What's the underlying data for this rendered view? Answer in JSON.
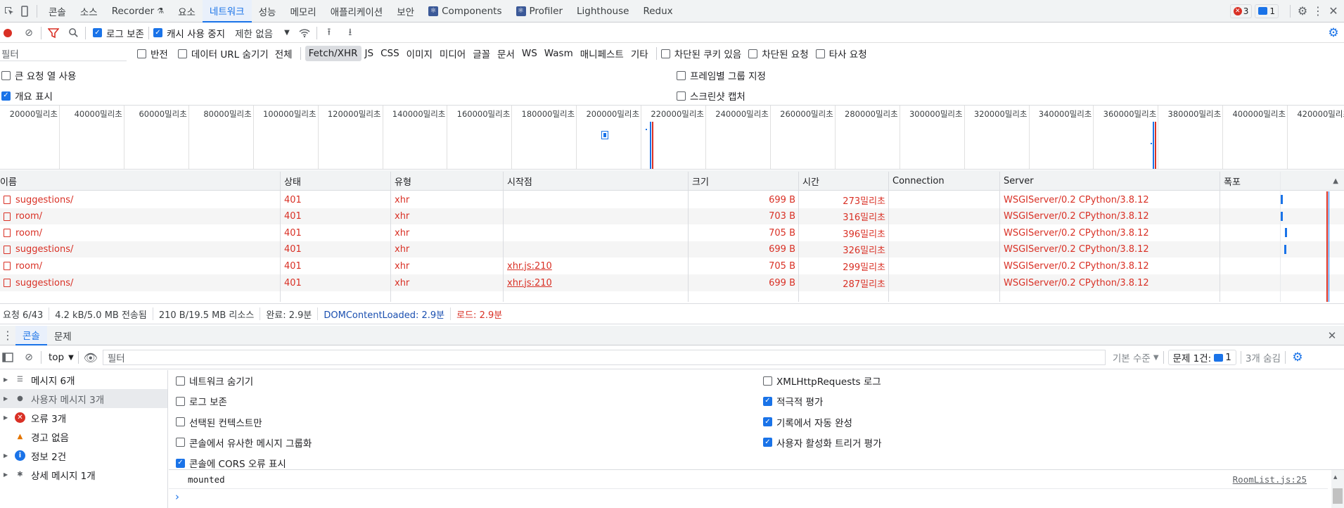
{
  "topbar": {
    "tabs": [
      "콘솔",
      "소스",
      "Recorder",
      "요소",
      "네트워크",
      "성능",
      "메모리",
      "애플리케이션",
      "보안",
      "Components",
      "Profiler",
      "Lighthouse",
      "Redux"
    ],
    "recorder_icon": "flask-icon",
    "error_count": "3",
    "message_count": "1"
  },
  "net_toolbar": {
    "preserve_log": "로그 보존",
    "disable_cache": "캐시 사용 중지",
    "throttle": "제한 없음"
  },
  "filter_bar": {
    "placeholder": "필터",
    "invert": "반전",
    "hide_data_urls": "데이터 URL 숨기기",
    "types": [
      "전체",
      "Fetch/XHR",
      "JS",
      "CSS",
      "이미지",
      "미디어",
      "글꼴",
      "문서",
      "WS",
      "Wasm",
      "매니페스트",
      "기타"
    ],
    "blocked_cookies": "차단된 쿠키 있음",
    "blocked_requests": "차단된 요청",
    "third_party": "타사 요청"
  },
  "settings": {
    "big_rows": "큰 요청 열 사용",
    "group_by_frame": "프레임별 그룹 지정",
    "show_overview": "개요 표시",
    "screenshots": "스크린샷 캡처"
  },
  "timeline": {
    "ticks": [
      "20000밀리초",
      "40000밀리초",
      "60000밀리초",
      "80000밀리초",
      "100000밀리초",
      "120000밀리초",
      "140000밀리초",
      "160000밀리초",
      "180000밀리초",
      "200000밀리초",
      "220000밀리초",
      "240000밀리초",
      "260000밀리초",
      "280000밀리초",
      "300000밀리초",
      "320000밀리초",
      "340000밀리초",
      "360000밀리초",
      "380000밀리초",
      "400000밀리초",
      "420000밀리초"
    ]
  },
  "table": {
    "headers": [
      "이름",
      "상태",
      "유형",
      "시작점",
      "크기",
      "시간",
      "Connection",
      "Server",
      "폭포"
    ],
    "rows": [
      {
        "name": "suggestions/",
        "status": "401",
        "type": "xhr",
        "initiator": "",
        "size": "699 B",
        "time": "273밀리초",
        "server": "WSGIServer/0.2 CPython/3.8.12"
      },
      {
        "name": "room/",
        "status": "401",
        "type": "xhr",
        "initiator": "",
        "size": "703 B",
        "time": "316밀리초",
        "server": "WSGIServer/0.2 CPython/3.8.12"
      },
      {
        "name": "room/",
        "status": "401",
        "type": "xhr",
        "initiator": "",
        "size": "705 B",
        "time": "396밀리초",
        "server": "WSGIServer/0.2 CPython/3.8.12"
      },
      {
        "name": "suggestions/",
        "status": "401",
        "type": "xhr",
        "initiator": "",
        "size": "699 B",
        "time": "326밀리초",
        "server": "WSGIServer/0.2 CPython/3.8.12"
      },
      {
        "name": "room/",
        "status": "401",
        "type": "xhr",
        "initiator": "xhr.js:210",
        "size": "705 B",
        "time": "299밀리초",
        "server": "WSGIServer/0.2 CPython/3.8.12"
      },
      {
        "name": "suggestions/",
        "status": "401",
        "type": "xhr",
        "initiator": "xhr.js:210",
        "size": "699 B",
        "time": "287밀리초",
        "server": "WSGIServer/0.2 CPython/3.8.12"
      }
    ]
  },
  "statusbar": {
    "requests": "요청 6/43",
    "transferred": "4.2 kB/5.0 MB 전송됨",
    "resources": "210 B/19.5 MB 리소스",
    "finish": "완료: 2.9분",
    "dcl": "DOMContentLoaded: 2.9분",
    "load": "로드: 2.9분"
  },
  "drawer": {
    "tabs": [
      "콘솔",
      "문제"
    ],
    "context": "top",
    "filter_placeholder": "필터",
    "level": "기본 수준",
    "issues": "문제 1건:",
    "issues_count": "1",
    "hidden": "3개 숨김"
  },
  "sidebar": {
    "items": [
      {
        "label": "메시지 6개",
        "icon": "list-icon"
      },
      {
        "label": "사용자 메시지 3개",
        "icon": "user-icon"
      },
      {
        "label": "오류 3개",
        "icon": "error-icon"
      },
      {
        "label": "경고 없음",
        "icon": "warning-icon"
      },
      {
        "label": "정보 2건",
        "icon": "info-icon"
      },
      {
        "label": "상세 메시지 1개",
        "icon": "bug-icon"
      }
    ]
  },
  "console_options": {
    "left": [
      "네트워크 숨기기",
      "로그 보존",
      "선택된 컨텍스트만",
      "콘솔에서 유사한 메시지 그룹화",
      "콘솔에 CORS 오류 표시"
    ],
    "right": [
      "XMLHttpRequests 로그",
      "적극적 평가",
      "기록에서 자동 완성",
      "사용자 활성화 트리거 평가"
    ]
  },
  "console": {
    "message": "mounted",
    "source": "RoomList.js:25",
    "prompt": "›"
  },
  "colors": {
    "accent": "#1a73e8",
    "error": "#d93025"
  }
}
